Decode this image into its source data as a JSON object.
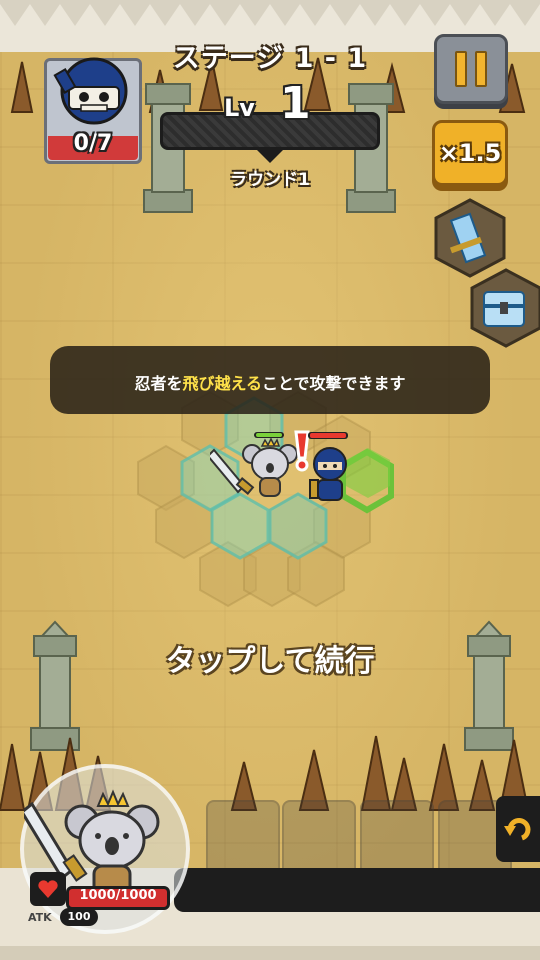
{
  "header": {
    "stage_title": "ステージ 1 - 1",
    "level_label": "Lv",
    "level_value": "1",
    "round_label": "ラウンド1"
  },
  "enemy_counter": {
    "defeated": "0/7",
    "icon": "ninja-skull-icon"
  },
  "controls": {
    "pause_icon": "pause-icon",
    "speed_label": "×1.5"
  },
  "side_items": [
    {
      "icon": "scroll-icon"
    },
    {
      "icon": "treasure-chest-icon"
    }
  ],
  "tutorial": {
    "text_before": "忍者を",
    "highlight": "飛び越える",
    "text_after": "ことで攻撃できます"
  },
  "prompt": {
    "tap_to_continue": "タップして続行"
  },
  "player": {
    "hp_text": "1000/1000",
    "atk_label": "ATK",
    "atk_value": "100",
    "hp_fraction": 1.0
  },
  "colors": {
    "ground": "#d6b565",
    "highlight_text": "#ffe24a",
    "hp_red": "#d12f2f",
    "speed_gold": "#f0b128",
    "target_hex_green": "#6cc23a",
    "move_hex_teal": "#7fd6c2"
  }
}
